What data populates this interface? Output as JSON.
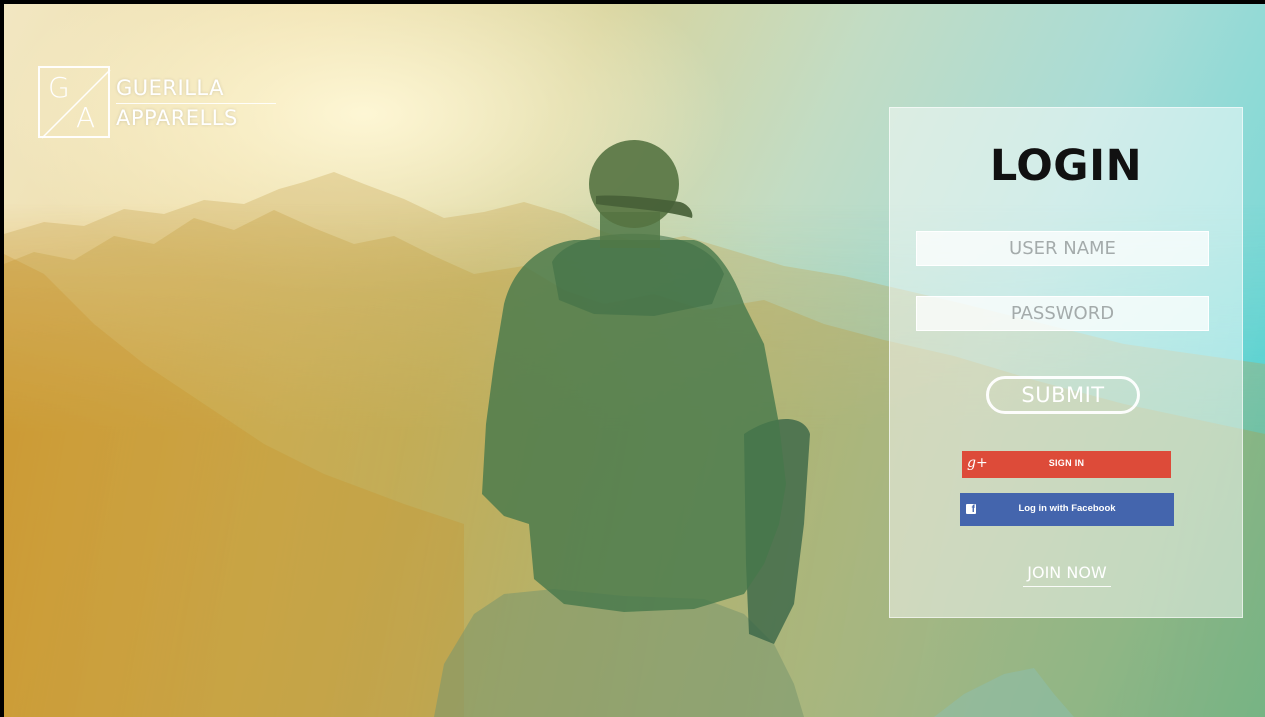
{
  "brand": {
    "monogram_top": "G",
    "monogram_bottom": "A",
    "line1": "GUERILLA",
    "line2": "APPARELLS"
  },
  "login": {
    "title": "LOGIN",
    "username_placeholder": "USER NAME",
    "password_placeholder": "PASSWORD",
    "submit_label": "SUBMIT",
    "google_label": "SIGN IN",
    "google_icon": "g+",
    "facebook_label": "Log in with Facebook",
    "facebook_icon": "f",
    "join_label": "JOIN NOW"
  },
  "colors": {
    "google": "#dd4b39",
    "facebook": "#4465ad",
    "title": "#111111"
  }
}
